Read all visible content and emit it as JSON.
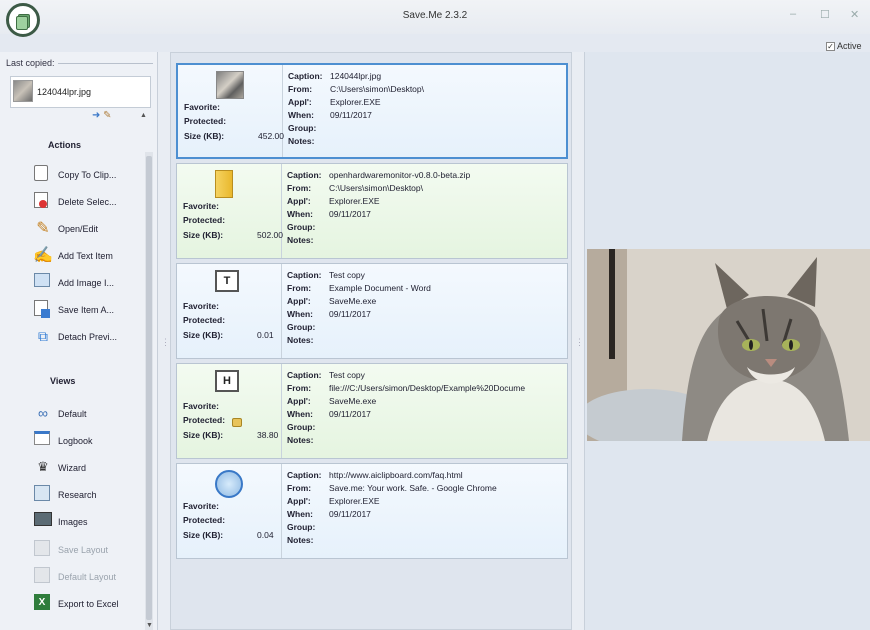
{
  "window": {
    "title": "Save.Me 2.3.2",
    "minimize": "–",
    "maximize": "☐",
    "close": "✕"
  },
  "active_checkbox": {
    "label": "Active",
    "checked": true,
    "mark": "✓"
  },
  "last_copied": {
    "label": "Last copied:",
    "item": "124044lpr.jpg"
  },
  "actions": {
    "title": "Actions",
    "items": [
      {
        "label": "Copy To Clip...",
        "icon": "clipboard-icon"
      },
      {
        "label": "Delete Selec...",
        "icon": "delete-icon"
      },
      {
        "label": "Open/Edit",
        "icon": "pencil-icon"
      },
      {
        "label": "Add Text Item",
        "icon": "add-text-icon"
      },
      {
        "label": "Add Image I...",
        "icon": "add-image-icon"
      },
      {
        "label": "Save Item A...",
        "icon": "save-icon"
      },
      {
        "label": "Detach Previ...",
        "icon": "detach-icon"
      }
    ]
  },
  "views": {
    "title": "Views",
    "items": [
      {
        "label": "Default",
        "icon": "binoculars-icon",
        "enabled": true
      },
      {
        "label": "Logbook",
        "icon": "logbook-icon",
        "enabled": true
      },
      {
        "label": "Wizard",
        "icon": "wizard-icon",
        "enabled": true
      },
      {
        "label": "Research",
        "icon": "research-icon",
        "enabled": true
      },
      {
        "label": "Images",
        "icon": "images-icon",
        "enabled": true
      },
      {
        "label": "Save Layout",
        "icon": "save-layout-icon",
        "enabled": false
      },
      {
        "label": "Default Layout",
        "icon": "default-layout-icon",
        "enabled": false
      },
      {
        "label": "Export to Excel",
        "icon": "excel-icon",
        "enabled": true
      }
    ]
  },
  "field_labels": {
    "favorite": "Favorite:",
    "protected": "Protected:",
    "size": "Size (KB):",
    "caption": "Caption:",
    "from": "From:",
    "appl": "Appl':",
    "when": "When:",
    "group": "Group:",
    "notes": "Notes:"
  },
  "items": [
    {
      "size": "452.00",
      "caption": "124044lpr.jpg",
      "from": "C:\\Users\\simon\\Desktop\\",
      "appl": "Explorer.EXE",
      "when": "09/11/2017",
      "group": "",
      "notes": "",
      "protected": false,
      "thumb": "photo-thumbnail",
      "color": "#eaf4fc"
    },
    {
      "size": "502.00",
      "caption": "openhardwaremonitor-v0.8.0-beta.zip",
      "from": "C:\\Users\\simon\\Desktop\\",
      "appl": "Explorer.EXE",
      "when": "09/11/2017",
      "group": "",
      "notes": "",
      "protected": false,
      "thumb": "zip-file-icon",
      "color": "#e9f5e4"
    },
    {
      "size": "0.01",
      "caption": "Test copy",
      "from": "Example Document - Word",
      "appl": "SaveMe.exe",
      "when": "09/11/2017",
      "group": "",
      "notes": "",
      "protected": false,
      "thumb": "text-document-icon",
      "thumb_glyph": "T",
      "color": "#eaf4fc"
    },
    {
      "size": "38.80",
      "caption": "Test copy",
      "from": "file:///C:/Users/simon/Desktop/Example%20Docume",
      "appl": "SaveMe.exe",
      "when": "09/11/2017",
      "group": "",
      "notes": "",
      "protected": true,
      "thumb": "html-document-icon",
      "thumb_glyph": "H",
      "color": "#e9f5e4"
    },
    {
      "size": "0.04",
      "caption": "http://www.aiclipboard.com/faq.html",
      "from": "Save.me: Your work. Safe. - Google Chrome",
      "appl": "Explorer.EXE",
      "when": "09/11/2017",
      "group": "",
      "notes": "",
      "protected": false,
      "thumb": "web-globe-icon",
      "color": "#eaf4fc"
    }
  ],
  "preview": {
    "image": "cat-photo"
  }
}
